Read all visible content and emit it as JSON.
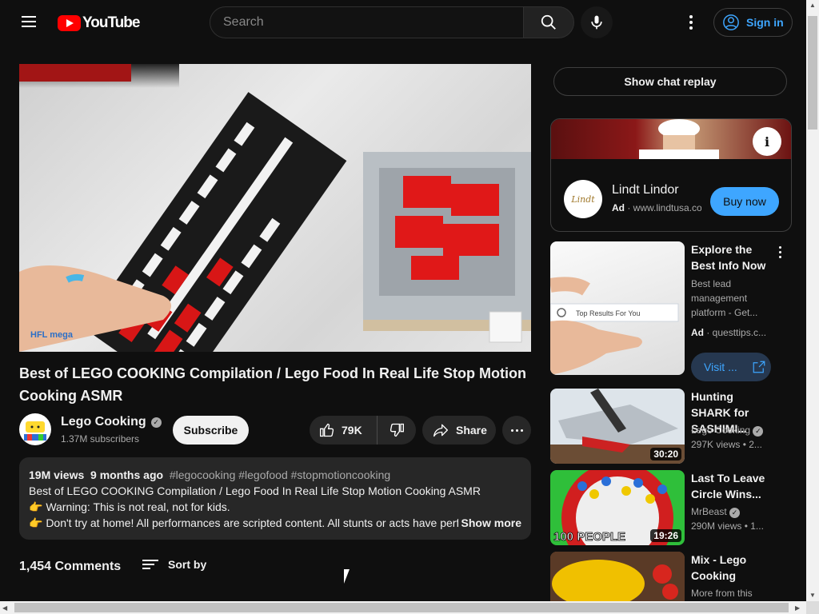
{
  "header": {
    "logo_text": "YouTube",
    "search_placeholder": "Search",
    "signin_label": "Sign in"
  },
  "video": {
    "title": "Best of LEGO COOKING Compilation / Lego Food In Real Life Stop Motion Cooking ASMR",
    "watermark_left": "HFL mega"
  },
  "channel": {
    "name": "Lego Cooking",
    "subscribers": "1.37M subscribers",
    "subscribe_label": "Subscribe"
  },
  "actions": {
    "likes": "79K",
    "share_label": "Share"
  },
  "description": {
    "views": "19M views",
    "age": "9 months ago",
    "tags": "#legocooking #legofood #stopmotioncooking",
    "line1": "Best of LEGO COOKING Compilation / Lego Food In Real Life Stop Motion Cooking ASMR",
    "line2": "👉 Warning: This is not real, not for kids.",
    "line3": "👉 Don't try at home! All performances are scripted content. All stunts or acts have performed",
    "show_more": "Show more"
  },
  "comments": {
    "count": "1,454 Comments",
    "sort_label": "Sort by"
  },
  "sidebar": {
    "chat_replay": "Show chat replay",
    "ad": {
      "name": "Lindt Lindor",
      "badge": "Ad",
      "url": "www.lindtusa.com",
      "cta": "Buy now",
      "logo_text": "Lindt"
    },
    "ad2": {
      "title": "Explore the Best Info Now",
      "description": "Best lead management platform - Get...",
      "badge": "Ad",
      "url": "questtips.c...",
      "cta": "Visit ...",
      "thumb_text": "Top Results For You"
    },
    "recommendations": [
      {
        "title": "Hunting SHARK for SASHIMI...",
        "channel": "Lego Cooking",
        "meta": "297K views • 2...",
        "duration": "30:20"
      },
      {
        "title": "Last To Leave Circle Wins...",
        "channel": "MrBeast",
        "meta": "290M views • 1...",
        "duration": "19:26",
        "thumb_text": "100 PEOPLE"
      },
      {
        "title": "Mix - Lego Cooking",
        "channel": "More from this",
        "meta": ""
      }
    ]
  },
  "colors": {
    "background": "#0f0f0f",
    "accent_blue": "#3ea6ff",
    "brand_red": "#ff0000"
  }
}
